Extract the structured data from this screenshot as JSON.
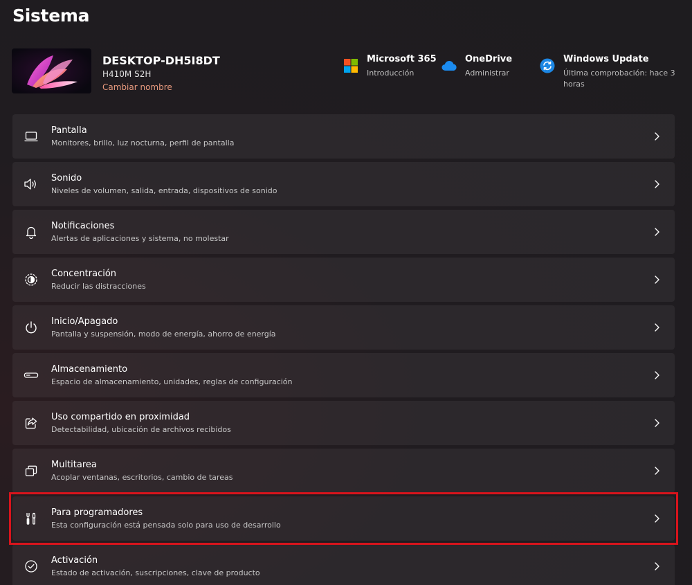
{
  "page": {
    "title": "Sistema"
  },
  "device": {
    "name": "DESKTOP-DH5I8DT",
    "model": "H410M S2H",
    "rename_label": "Cambiar nombre"
  },
  "quick_links": [
    {
      "title": "Microsoft 365",
      "subtitle": "Introducción",
      "icon": "microsoft-logo-icon"
    },
    {
      "title": "OneDrive",
      "subtitle": "Administrar",
      "icon": "onedrive-cloud-icon"
    },
    {
      "title": "Windows Update",
      "subtitle": "Última comprobación: hace 3 horas",
      "icon": "windows-update-icon"
    }
  ],
  "settings": [
    {
      "title": "Pantalla",
      "subtitle": "Monitores, brillo, luz nocturna, perfil de pantalla",
      "icon": "display-icon"
    },
    {
      "title": "Sonido",
      "subtitle": "Niveles de volumen, salida, entrada, dispositivos de sonido",
      "icon": "speaker-icon"
    },
    {
      "title": "Notificaciones",
      "subtitle": "Alertas de aplicaciones y sistema, no molestar",
      "icon": "bell-icon"
    },
    {
      "title": "Concentración",
      "subtitle": "Reducir las distracciones",
      "icon": "focus-icon"
    },
    {
      "title": "Inicio/Apagado",
      "subtitle": "Pantalla y suspensión, modo de energía, ahorro de energía",
      "icon": "power-icon"
    },
    {
      "title": "Almacenamiento",
      "subtitle": "Espacio de almacenamiento, unidades, reglas de configuración",
      "icon": "storage-icon"
    },
    {
      "title": "Uso compartido en proximidad",
      "subtitle": "Detectabilidad, ubicación de archivos recibidos",
      "icon": "share-icon"
    },
    {
      "title": "Multitarea",
      "subtitle": "Acoplar ventanas, escritorios, cambio de tareas",
      "icon": "multitask-icon"
    },
    {
      "title": "Para programadores",
      "subtitle": "Esta configuración está pensada solo para uso de desarrollo",
      "icon": "developer-tools-icon"
    },
    {
      "title": "Activación",
      "subtitle": "Estado de activación, suscripciones, clave de producto",
      "icon": "checkmark-circle-icon"
    }
  ],
  "colors": {
    "accent_link": "#e89a7e",
    "highlight_border": "#d8141c",
    "row_background": "#2c292c"
  }
}
